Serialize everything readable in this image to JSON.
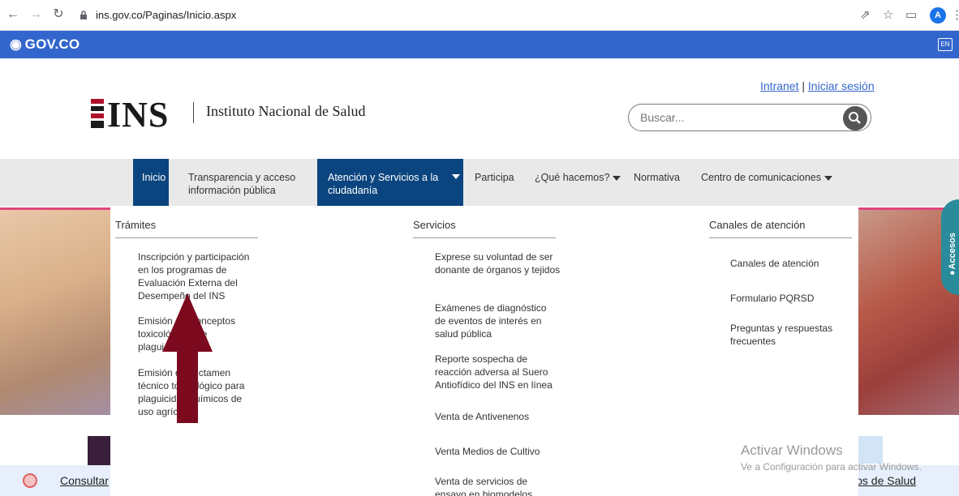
{
  "browser": {
    "url": "ins.gov.co/Paginas/Inicio.aspx",
    "avatar_letter": "A"
  },
  "govbar": {
    "logo": "GOV.CO",
    "lang_button": "EN",
    "color": "#3366cc"
  },
  "header": {
    "logo_text": "INS",
    "institute_name": "Instituto Nacional de Salud",
    "links": {
      "intranet": "Intranet",
      "separator": "|",
      "login": "Iniciar sesión"
    },
    "search_placeholder": "Buscar..."
  },
  "menu": {
    "items": [
      {
        "label": "Inicio"
      },
      {
        "label": "Transparencia y acceso información pública"
      },
      {
        "label": "Atención y Servicios a la ciudadanía"
      },
      {
        "label": "Participa"
      },
      {
        "label": "¿Qué hacemos?"
      },
      {
        "label": "Normativa"
      },
      {
        "label": "Centro de comunicaciones"
      }
    ],
    "active_color": "#0b457f"
  },
  "mega_menu": {
    "tramites": {
      "title": "Trámites",
      "links": [
        "Inscripción y participación en los programas de Evaluación Externa del Desempeño del INS",
        "Emisión de Conceptos toxicológicos de plaguicidas",
        "Emisión del dictamen técnico toxicológico para plaguicidas químicos de uso agrícola"
      ]
    },
    "servicios": {
      "title": "Servicios",
      "links": [
        "Exprese su voluntad de ser donante de órganos y tejidos",
        "Exámenes de diagnóstico de eventos de interés en salud pública",
        "Reporte sospecha de reacción adversa al Suero Antiofídico del INS en línea",
        "Venta de Antivenenos",
        "Venta Medios de Cultivo",
        "Venta de servicios de ensayo en biomodelos"
      ]
    },
    "canales": {
      "title": "Canales de atención",
      "links": [
        "Canales de atención",
        "Formulario PQRSD",
        "Preguntas y respuestas frecuentes"
      ]
    }
  },
  "accesos": {
    "label": "Accesos",
    "color": "#2a8b9a"
  },
  "bottom": {
    "consultar": "Consultar",
    "salud": "ios de Salud"
  },
  "watermark": {
    "title": "Activar Windows",
    "subtitle": "Ve a Configuración para activar Windows."
  },
  "annotation": {
    "arrow_color": "#7b0a1e"
  }
}
